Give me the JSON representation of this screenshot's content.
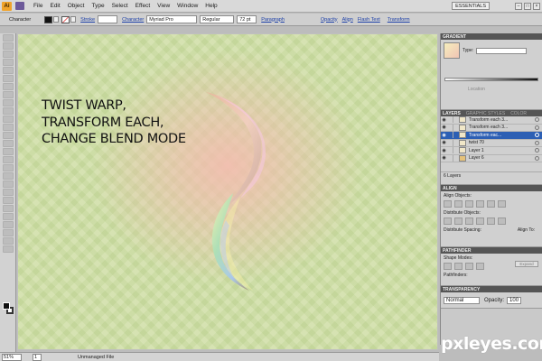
{
  "app": {
    "logo": "Ai"
  },
  "menu": [
    "File",
    "Edit",
    "Object",
    "Type",
    "Select",
    "Effect",
    "View",
    "Window",
    "Help"
  ],
  "workspace": "ESSENTIALS",
  "control_bar": {
    "mode": "Character",
    "stroke_label": "Stroke",
    "character_label": "Character",
    "font": "Myriad Pro",
    "style": "Regular",
    "size": "72 pt",
    "paragraph_label": "Paragraph",
    "opacity_label": "Opacity",
    "align_label": "Align",
    "flash_text_label": "Flash Text",
    "transform_label": "Transform"
  },
  "canvas": {
    "headline": [
      "TWIST WARP,",
      "TRANSFORM EACH,",
      "CHANGE BLEND MODE"
    ],
    "background_color": "#cfdea5",
    "glow_color": "#f4bcb0"
  },
  "statusbar": {
    "zoom": "51%",
    "page": "1",
    "status": "Unmanaged File"
  },
  "gradient_panel": {
    "title": "GRADIENT",
    "type_label": "Type:",
    "location_label": "Location"
  },
  "layers_panel": {
    "tabs": [
      "LAYERS",
      "GRAPHIC STYLES",
      "COLOR"
    ],
    "layers": [
      {
        "name": "Transform each 3...",
        "selected": false
      },
      {
        "name": "Transform each 3...",
        "selected": false
      },
      {
        "name": "Transform eac...",
        "selected": true
      },
      {
        "name": "twist 70",
        "selected": false
      },
      {
        "name": "Layer 1",
        "selected": false
      },
      {
        "name": "Layer 6",
        "selected": false
      }
    ],
    "count": "6 Layers",
    "selection_color": "#2c5fb4"
  },
  "align_panel": {
    "title": "ALIGN",
    "align_objects": "Align Objects:",
    "distribute_objects": "Distribute Objects:",
    "distribute_spacing": "Distribute Spacing:",
    "align_to": "Align To:"
  },
  "pathfinder_panel": {
    "title": "PATHFINDER",
    "shape_modes": "Shape Modes:",
    "expand": "Expand",
    "pathfinders": "Pathfinders:"
  },
  "transparency_panel": {
    "title": "TRANSPARENCY",
    "blend_mode": "Normal",
    "opacity_label": "Opacity:",
    "opacity": "100"
  },
  "watermark": "pxleyes.com"
}
